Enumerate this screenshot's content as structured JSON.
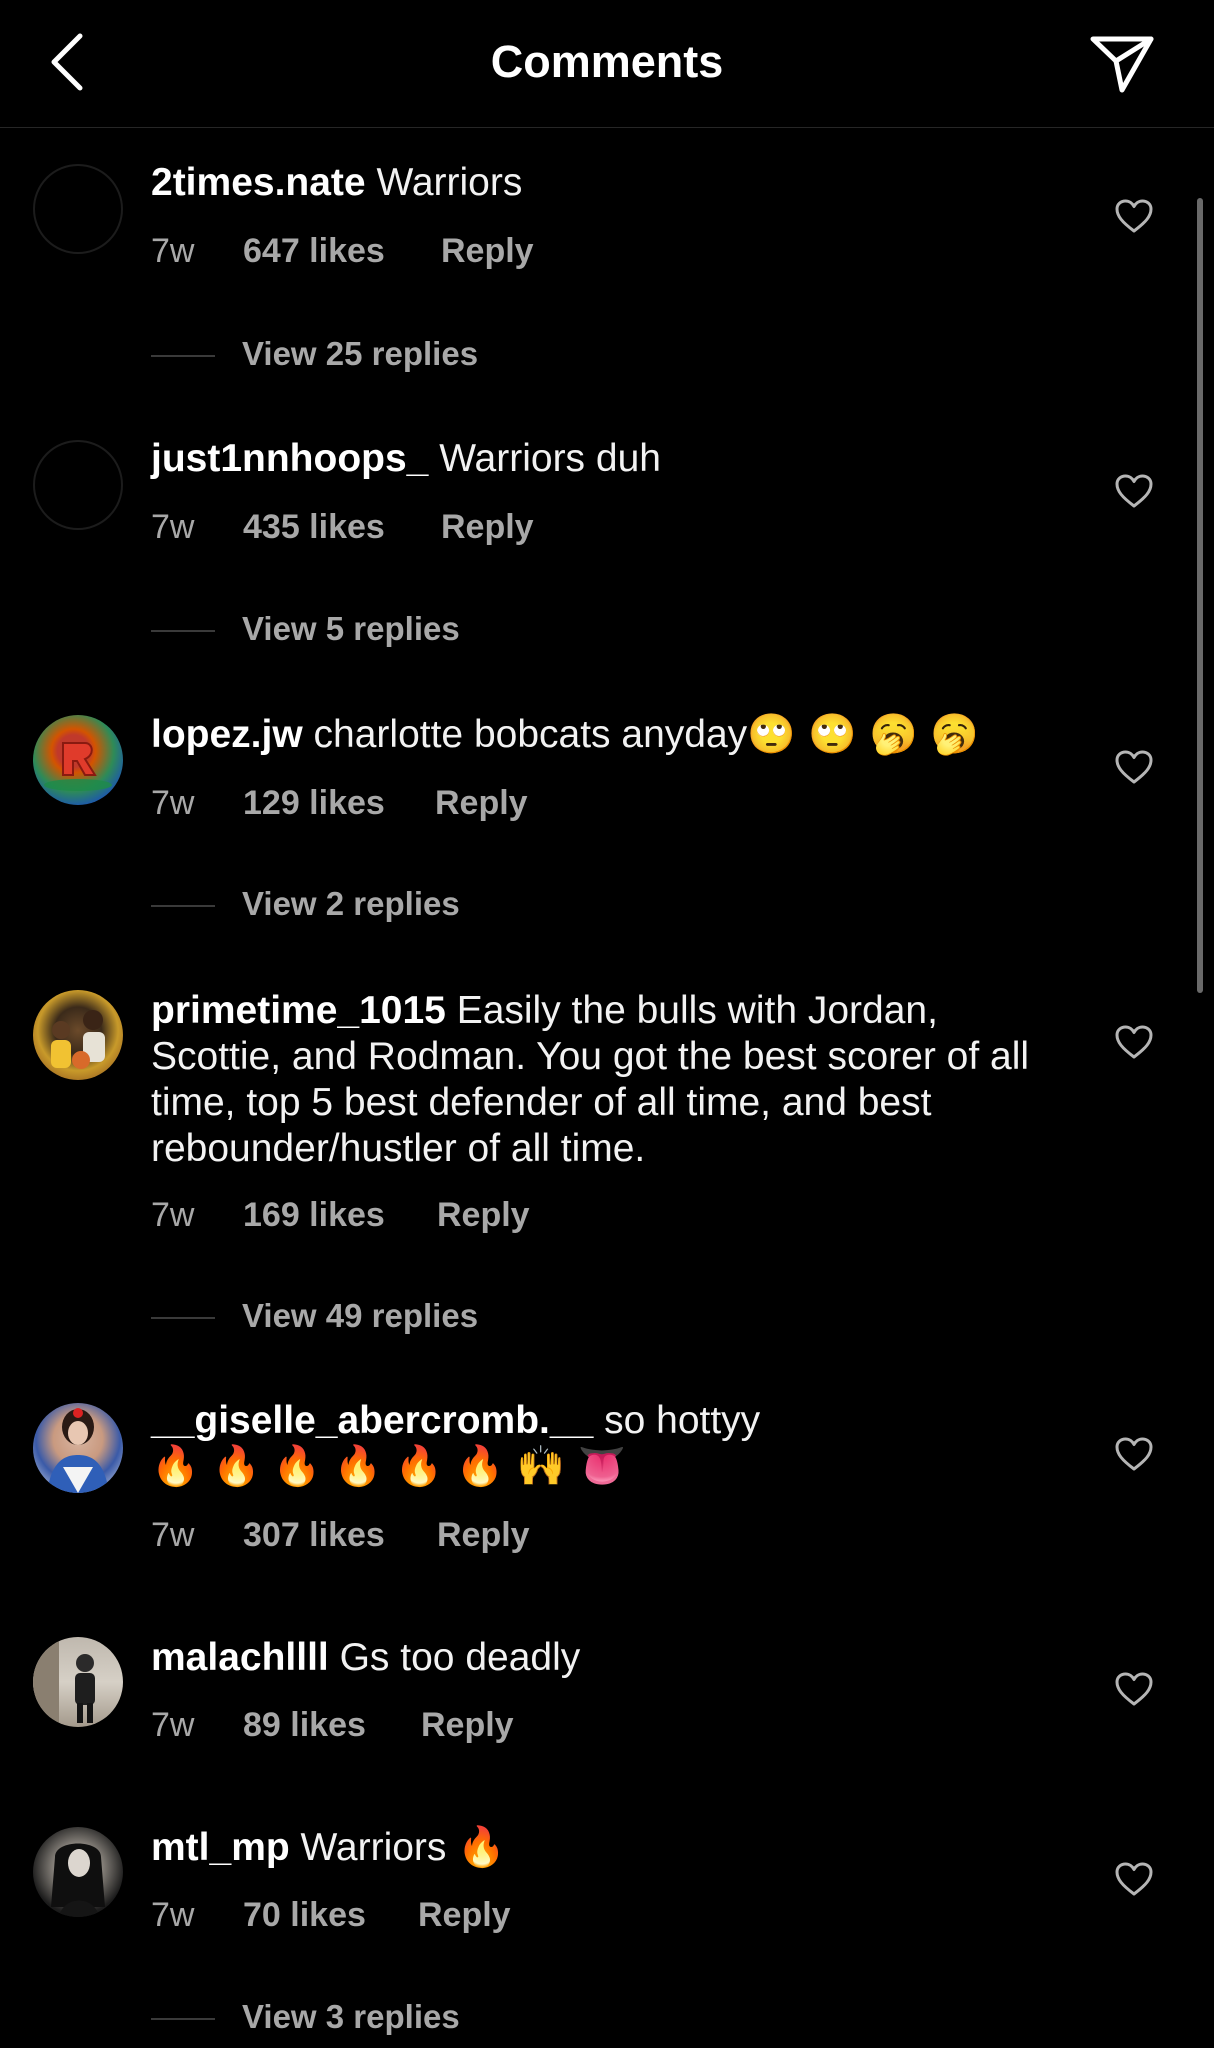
{
  "header": {
    "title": "Comments",
    "back_icon": "chevron-left-icon",
    "send_icon": "paper-plane-icon"
  },
  "comments": [
    {
      "username": "2times.nate",
      "text": "Warriors",
      "emoji": "",
      "time": "7w",
      "likes": "647 likes",
      "reply": "Reply",
      "view_replies": "View 25 replies"
    },
    {
      "username": "just1nnhoops_",
      "text": "Warriors duh",
      "emoji": "",
      "time": "7w",
      "likes": "435 likes",
      "reply": "Reply",
      "view_replies": "View 5 replies"
    },
    {
      "username": "lopez.jw",
      "text": "charlotte bobcats anyday",
      "emoji": "🙄 🙄 🥱 🥱",
      "time": "7w",
      "likes": "129 likes",
      "reply": "Reply",
      "view_replies": "View 2 replies"
    },
    {
      "username": "primetime_1015",
      "text": "Easily the bulls with Jordan, Scottie, and Rodman. You got the best scorer of all time, top 5 best defender of all time, and best rebounder/hustler of all time.",
      "emoji": "",
      "time": "7w",
      "likes": "169 likes",
      "reply": "Reply",
      "view_replies": "View 49 replies"
    },
    {
      "username": "__giselle_abercromb.__",
      "text": "so hottyy",
      "emoji": "🔥 🔥 🔥 🔥 🔥 🔥 🙌 👅",
      "time": "7w",
      "likes": "307 likes",
      "reply": "Reply",
      "view_replies": ""
    },
    {
      "username": "malachllll",
      "text": "Gs too deadly",
      "emoji": "",
      "time": "7w",
      "likes": "89 likes",
      "reply": "Reply",
      "view_replies": ""
    },
    {
      "username": "mtl_mp",
      "text": "Warriors",
      "emoji": "🔥",
      "time": "7w",
      "likes": "70 likes",
      "reply": "Reply",
      "view_replies": "View 3 replies"
    }
  ],
  "colors": {
    "background": "#000000",
    "text": "#f2f2f2",
    "secondary_text": "#a8a8a8"
  }
}
